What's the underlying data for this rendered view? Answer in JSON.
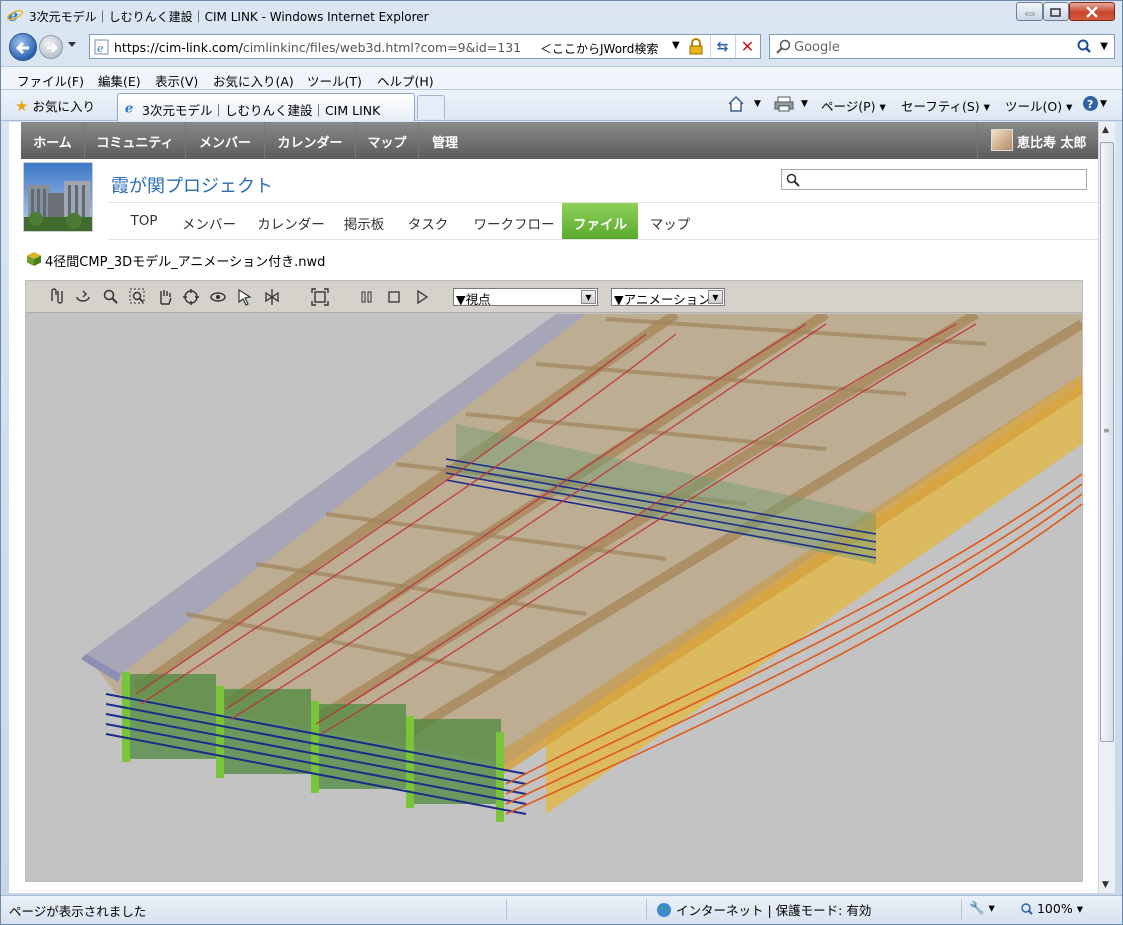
{
  "window": {
    "title": "3次元モデル｜しむりんく建設｜CIM LINK - Windows Internet Explorer"
  },
  "address": {
    "url_host": "https://cim-link.com/",
    "url_path": "cimlinkinc/files/web3d.html?com=9&id=131",
    "jword": "＜ここからJWord検索",
    "search_placeholder": "Google"
  },
  "menu": [
    "ファイル(F)",
    "編集(E)",
    "表示(V)",
    "お気に入り(A)",
    "ツール(T)",
    "ヘルプ(H)"
  ],
  "favorites_label": "お気に入り",
  "tab_label": "3次元モデル｜しむりんく建設｜CIM LINK",
  "commands": {
    "page": "ページ(P)",
    "safety": "セーフティ(S)",
    "tools": "ツール(O)"
  },
  "site_nav": [
    "ホーム",
    "コミュニティ",
    "メンバー",
    "カレンダー",
    "マップ",
    "管理"
  ],
  "user_name": "恵比寿 太郎",
  "project": {
    "title": "霞が関プロジェクト"
  },
  "sub_nav": [
    "TOP",
    "メンバー",
    "カレンダー",
    "掲示板",
    "タスク",
    "ワークフロー",
    "ファイル",
    "マップ"
  ],
  "sub_nav_active": "ファイル",
  "file": {
    "name": "4径間CMP_3Dモデル_アニメーション付き.nwd"
  },
  "viewer": {
    "viewpoint_select": "▼視点",
    "animation_select": "▼アニメーション",
    "tools": [
      "walk-icon",
      "orbit-icon",
      "zoom-icon",
      "zoom-window-icon",
      "pan-icon",
      "turntable-icon",
      "look-around-icon",
      "select-icon",
      "section-icon",
      "fit-view-icon",
      "pause-icon",
      "stop-icon",
      "play-icon"
    ]
  },
  "status": {
    "text": "ページが表示されました",
    "zone": "インターネット | 保護モード: 有効",
    "zoom": "100%"
  },
  "colors": {
    "accent_green": "#5aa92d",
    "nav_gray": "#5b5b5b",
    "link_blue": "#2a6db5"
  }
}
